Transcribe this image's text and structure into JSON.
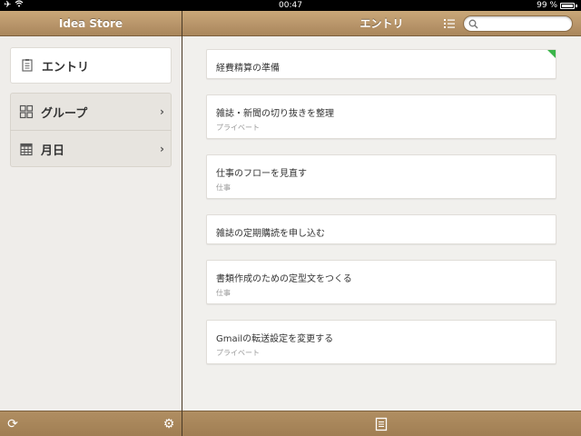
{
  "status_bar": {
    "time": "00:47",
    "battery": "99 %"
  },
  "sidebar": {
    "title": "Idea Store",
    "items": [
      {
        "label": "エントリ"
      },
      {
        "label": "グループ"
      },
      {
        "label": "月日"
      }
    ]
  },
  "main": {
    "title": "エントリ",
    "search": {
      "placeholder": ""
    },
    "entries": [
      {
        "title": "経費精算の準備",
        "subtitle": ""
      },
      {
        "title": "雑誌・新聞の切り抜きを整理",
        "subtitle": "プライベート"
      },
      {
        "title": "仕事のフローを見直す",
        "subtitle": "仕事"
      },
      {
        "title": "雑誌の定期購読を申し込む",
        "subtitle": ""
      },
      {
        "title": "書類作成のための定型文をつくる",
        "subtitle": "仕事"
      },
      {
        "title": "Gmailの転送設定を変更する",
        "subtitle": "プライベート"
      }
    ]
  },
  "colors": {
    "flag": "#3bb54a",
    "wood": "#b8956a"
  },
  "icons": [
    "airplane-icon",
    "wifi-icon",
    "battery-icon",
    "entry-icon",
    "grid-icon",
    "calendar-icon",
    "chevron-right-icon",
    "list-icon",
    "search-icon",
    "sync-icon",
    "gear-icon",
    "compose-icon"
  ]
}
